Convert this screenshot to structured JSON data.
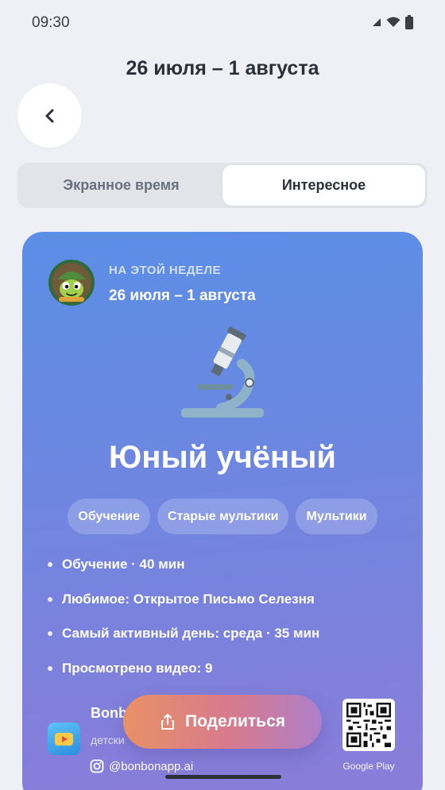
{
  "status_bar": {
    "time": "09:30"
  },
  "header": {
    "title": "26 июля – 1 августа",
    "back_icon": "chevron-left-icon"
  },
  "tabs": [
    {
      "label": "Экранное время",
      "active": false
    },
    {
      "label": "Интересное",
      "active": true
    }
  ],
  "card": {
    "week_label": "НА ЭТОЙ НЕДЕЛЕ",
    "week_range": "26 июля – 1 августа",
    "badge_icon": "microscope-icon",
    "badge_title": "Юный учёный",
    "chips": [
      "Обучение",
      "Старые мультики",
      "Мультики"
    ],
    "stats": [
      "Обучение · 40 мин",
      "Любимое: Открытое Письмо Селезня",
      "Самый активный день: среда · 35 мин",
      "Просмотрено видео: 9"
    ],
    "brand_name": "Bonb",
    "brand_subtitle": "детски",
    "instagram_handle": "@bonbonapp.ai",
    "qr_caption": "Google Play"
  },
  "share_button": {
    "label": "Поделиться",
    "icon": "share-icon"
  },
  "colors": {
    "background": "#eff0f5",
    "card_gradient_top": "#5b8ee6",
    "card_gradient_bottom": "#8b7cd8",
    "share_gradient_start": "#e99166",
    "share_gradient_end": "#ae7fc9"
  }
}
